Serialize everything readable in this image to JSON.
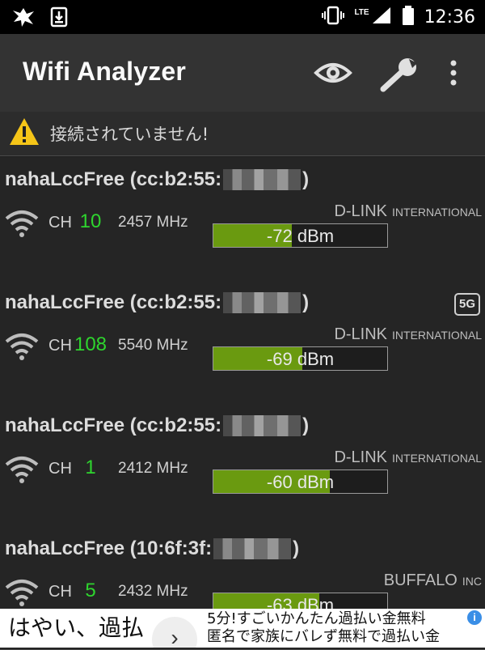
{
  "status_bar": {
    "time": "12:36",
    "network_label": "LTE",
    "icons": [
      "notification-icon",
      "download-icon",
      "vibrate-icon",
      "signal-icon",
      "battery-icon"
    ]
  },
  "app_bar": {
    "title": "Wifi Analyzer",
    "actions": [
      "eye-icon",
      "wrench-icon",
      "overflow-menu-icon"
    ]
  },
  "warning": {
    "text": "接続されていません!",
    "icon": "warning-icon",
    "icon_color": "#f5c518"
  },
  "networks": [
    {
      "ssid_prefix": "nahaLccFree (cc:b2:55:",
      "ssid_suffix": ")",
      "badge": "",
      "vendor": "D-LINK",
      "vendor_sub": "INTERNATIONAL",
      "ch_label": "CH",
      "channel": "10",
      "frequency": "2457 MHz",
      "signal": "-72 dBm",
      "signal_dbm": -72,
      "signal_fill_pct": 45
    },
    {
      "ssid_prefix": "nahaLccFree (cc:b2:55:",
      "ssid_suffix": ")",
      "badge": "5G",
      "vendor": "D-LINK",
      "vendor_sub": "INTERNATIONAL",
      "ch_label": "CH",
      "channel": "108",
      "frequency": "5540 MHz",
      "signal": "-69 dBm",
      "signal_dbm": -69,
      "signal_fill_pct": 51
    },
    {
      "ssid_prefix": "nahaLccFree (cc:b2:55:",
      "ssid_suffix": ")",
      "badge": "",
      "vendor": "D-LINK",
      "vendor_sub": "INTERNATIONAL",
      "ch_label": "CH",
      "channel": "1",
      "frequency": "2412 MHz",
      "signal": "-60 dBm",
      "signal_dbm": -60,
      "signal_fill_pct": 67
    },
    {
      "ssid_prefix": "nahaLccFree (10:6f:3f:",
      "ssid_suffix": ")",
      "badge": "",
      "vendor": "BUFFALO",
      "vendor_sub": "INC",
      "ch_label": "CH",
      "channel": "5",
      "frequency": "2432 MHz",
      "signal": "-63 dBm",
      "signal_dbm": -63,
      "signal_fill_pct": 61
    }
  ],
  "colors": {
    "channel": "#2ed52e",
    "signal_bar": "#6a9a10",
    "app_bar": "#333333",
    "background": "#1f1f1f"
  },
  "ad": {
    "left_text": "はやい、過払",
    "right_line1": "5分!すごいかんたん過払い金無料",
    "right_line2": "匿名で家族にバレず無料で過払い金",
    "arrow_icon": "chevron-right-icon",
    "info_label": "i"
  }
}
